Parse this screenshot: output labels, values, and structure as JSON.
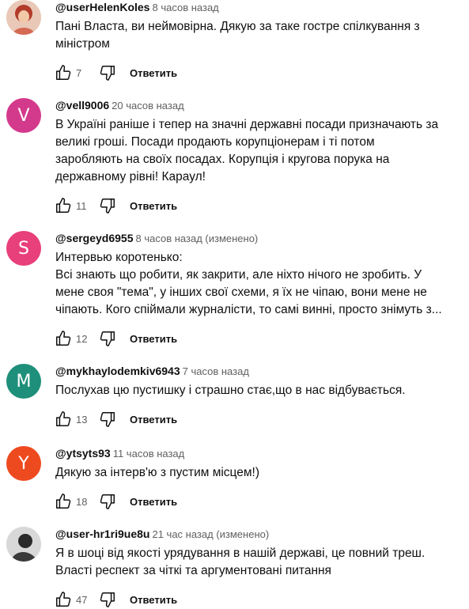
{
  "comments": [
    {
      "author": "@userHelenKoles",
      "time": "8 часов назад",
      "text_lines": [
        "Пані Власта, ви неймовірна. Дякую за таке гостре спілкування з",
        "міністром"
      ],
      "likes": "7",
      "reply_label": "Ответить",
      "avatar": {
        "type": "photo",
        "color": "#c8503a"
      }
    },
    {
      "author": "@vell9006",
      "time": "20 часов назад",
      "text_lines": [
        "В Україні раніше і тепер на значні державні посади призначають за",
        "великі гроші. Посади продають корупціонерам і ті потом",
        "заробляють на своїх посадах. Корупція і кругова порука на",
        "державному рівні! Караул!"
      ],
      "likes": "11",
      "reply_label": "Ответить",
      "avatar": {
        "type": "letter",
        "letter": "V",
        "color": "#d43a8c"
      }
    },
    {
      "author": "@sergeyd6955",
      "time": "8 часов назад (изменено)",
      "text_lines": [
        "Интервью коротенько:",
        "Всі знають що робити, як закрити, але ніхто нічого не зробить. У",
        "мене своя \"тема\", у інших свої схеми, я їх не чіпаю, вони мене не",
        "чіпають. Кого спіймали журналісти, то самі винні, просто знімуть з..."
      ],
      "likes": "12",
      "reply_label": "Ответить",
      "avatar": {
        "type": "letter",
        "letter": "S",
        "color": "#e8407a"
      }
    },
    {
      "author": "@mykhaylodemkiv6943",
      "time": "7 часов назад",
      "text_lines": [
        "Послухав цю пустишку і страшно стає,що в нас відбувається."
      ],
      "likes": "13",
      "reply_label": "Ответить",
      "avatar": {
        "type": "letter",
        "letter": "M",
        "color": "#1e8f7a"
      }
    },
    {
      "author": "@ytsyts93",
      "time": "11 часов назад",
      "text_lines": [
        "Дякую за інтерв'ю з пустим місцем!)"
      ],
      "likes": "18",
      "reply_label": "Ответить",
      "avatar": {
        "type": "letter",
        "letter": "Y",
        "color": "#ee4a20"
      }
    },
    {
      "author": "@user-hr1ri9ue8u",
      "time": "21 час назад (изменено)",
      "text_lines": [
        "Я в шоці від якості урядування в нашій державі, це повний треш.",
        "Власті респект за чіткі та аргументовані питання"
      ],
      "likes": "47",
      "reply_label": "Ответить",
      "avatar": {
        "type": "photo",
        "color": "#3a3a3a"
      }
    }
  ]
}
